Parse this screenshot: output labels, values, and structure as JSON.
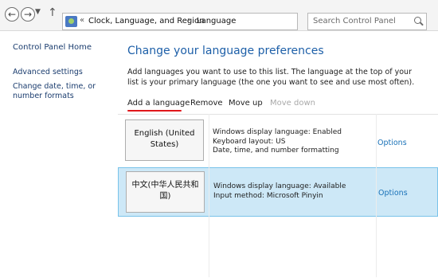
{
  "address_bar": {
    "breadcrumbs": [
      "Clock, Language, and Region",
      "Language"
    ],
    "overflow_chevron": "«",
    "search_placeholder": "Search Control Panel"
  },
  "sidebar": {
    "home": "Control Panel Home",
    "links": [
      "Advanced settings",
      "Change date, time, or number formats"
    ]
  },
  "main": {
    "title": "Change your language preferences",
    "description": "Add languages you want to use to this list. The language at the top of your list is your primary language (the one you want to see and use most often).",
    "toolbar": {
      "add": "Add a language",
      "remove": "Remove",
      "move_up": "Move up",
      "move_down": "Move down"
    },
    "languages": [
      {
        "name": "English (United States)",
        "info": [
          "Windows display language: Enabled",
          "Keyboard layout: US",
          "Date, time, and number formatting"
        ],
        "options": "Options",
        "selected": false
      },
      {
        "name": "中文(中华人民共和国)",
        "info": [
          "Windows display language: Available",
          "Input method: Microsoft Pinyin"
        ],
        "options": "Options",
        "selected": true
      }
    ]
  },
  "colors": {
    "title_blue": "#1d5fa8",
    "selection_bg": "#cde8f7",
    "selection_border": "#79c3ea",
    "annotation_red": "#e0161b"
  }
}
